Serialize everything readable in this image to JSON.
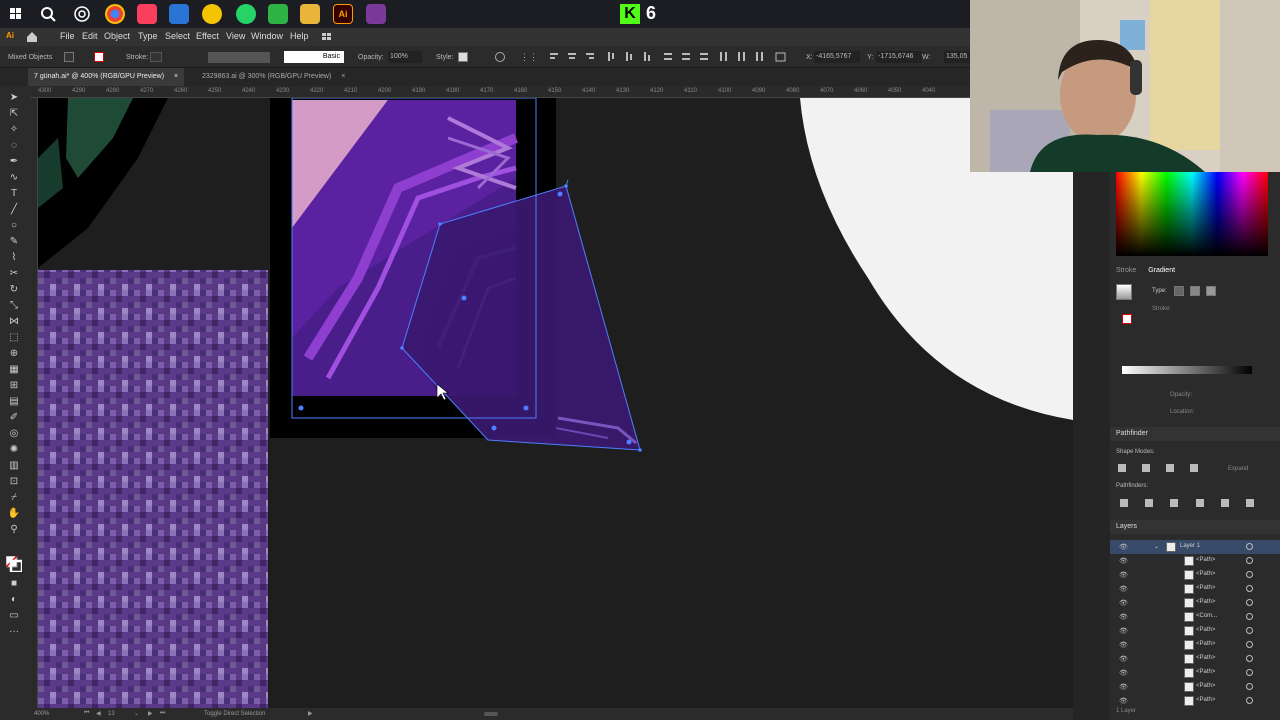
{
  "taskbar": {
    "icons": [
      "windows-start-icon",
      "search-icon",
      "chatgpt-icon",
      "chrome-icon",
      "music-icon",
      "mail-icon",
      "norton-icon",
      "whatsapp-icon",
      "store-icon",
      "file-explorer-icon",
      "illustrator-icon",
      "winrar-icon"
    ],
    "kick_logo": "K",
    "viewer_count": "6"
  },
  "menubar": {
    "items": [
      "File",
      "Edit",
      "Object",
      "Type",
      "Select",
      "Effect",
      "View",
      "Window",
      "Help"
    ]
  },
  "control_bar": {
    "selection": "Mixed Objects",
    "stroke_label": "Stroke:",
    "brush": "Basic",
    "opacity_label": "Opacity:",
    "opacity_value": "100%",
    "style_label": "Style:",
    "x_label": "X:",
    "x_value": "-4165,5767",
    "y_label": "Y:",
    "y_value": "-1715,6746",
    "w_label": "W:",
    "w_value": "135,05"
  },
  "doc_tabs": [
    {
      "title": "7 günah.ai* @ 400% (RGB/GPU Preview)",
      "active": true
    },
    {
      "title": "2329863.ai @ 300% (RGB/GPU Preview)",
      "active": false
    }
  ],
  "ruler": {
    "ticks": [
      "4300",
      "4290",
      "4280",
      "4270",
      "4260",
      "4250",
      "4240",
      "4230",
      "4220",
      "4210",
      "4200",
      "4190",
      "4180",
      "4170",
      "4160",
      "4150",
      "4140",
      "4130",
      "4120",
      "4110",
      "4100",
      "4090",
      "4080",
      "4070",
      "4060",
      "4050",
      "4040"
    ]
  },
  "statusbar": {
    "zoom": "400%",
    "page": "13",
    "tool_hint": "Toggle Direct Selection"
  },
  "colors": {
    "selection_blue": "#4d7fff",
    "purple_dark": "#3a1870",
    "purple_mid": "#5a1f9c",
    "pink": "#d49bc7"
  },
  "stroke_panel": {
    "tab_stroke": "Stroke",
    "tab_gradient": "Gradient",
    "type_label": "Type:",
    "stroke_label": "Stroke:",
    "opacity_label": "Opacity:",
    "location_label": "Location:"
  },
  "pathfinder": {
    "title": "Pathfinder",
    "shape_modes": "Shape Modes:",
    "expand": "Expand",
    "pathfinders": "Pathfinders:"
  },
  "layers": {
    "title": "Layers",
    "layer_name": "Layer 1",
    "rows": [
      "<Path>",
      "<Path>",
      "<Path>",
      "<Path>",
      "<Com...",
      "<Path>",
      "<Path>",
      "<Path>",
      "<Path>",
      "<Path>",
      "<Path>"
    ],
    "footer": "1 Layer"
  }
}
